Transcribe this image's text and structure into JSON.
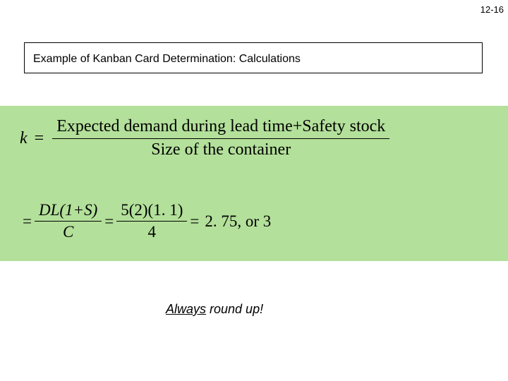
{
  "page_number": "12-16",
  "title": "Example of Kanban Card Determination: Calculations",
  "formula": {
    "lhs_var": "k",
    "lhs_eq": "=",
    "numerator_text": "Expected demand during lead time+Safety stock",
    "denominator_text": "Size of the container"
  },
  "calc": {
    "eq1": "=",
    "sym_num": "DL(1+S)",
    "sym_den": "C",
    "eq2": "=",
    "val_num": "5(2)(1. 1)",
    "val_den": "4",
    "eq3": "=",
    "result": "2. 75, or 3"
  },
  "footnote": {
    "underlined": "Always",
    "rest": " round up!"
  }
}
